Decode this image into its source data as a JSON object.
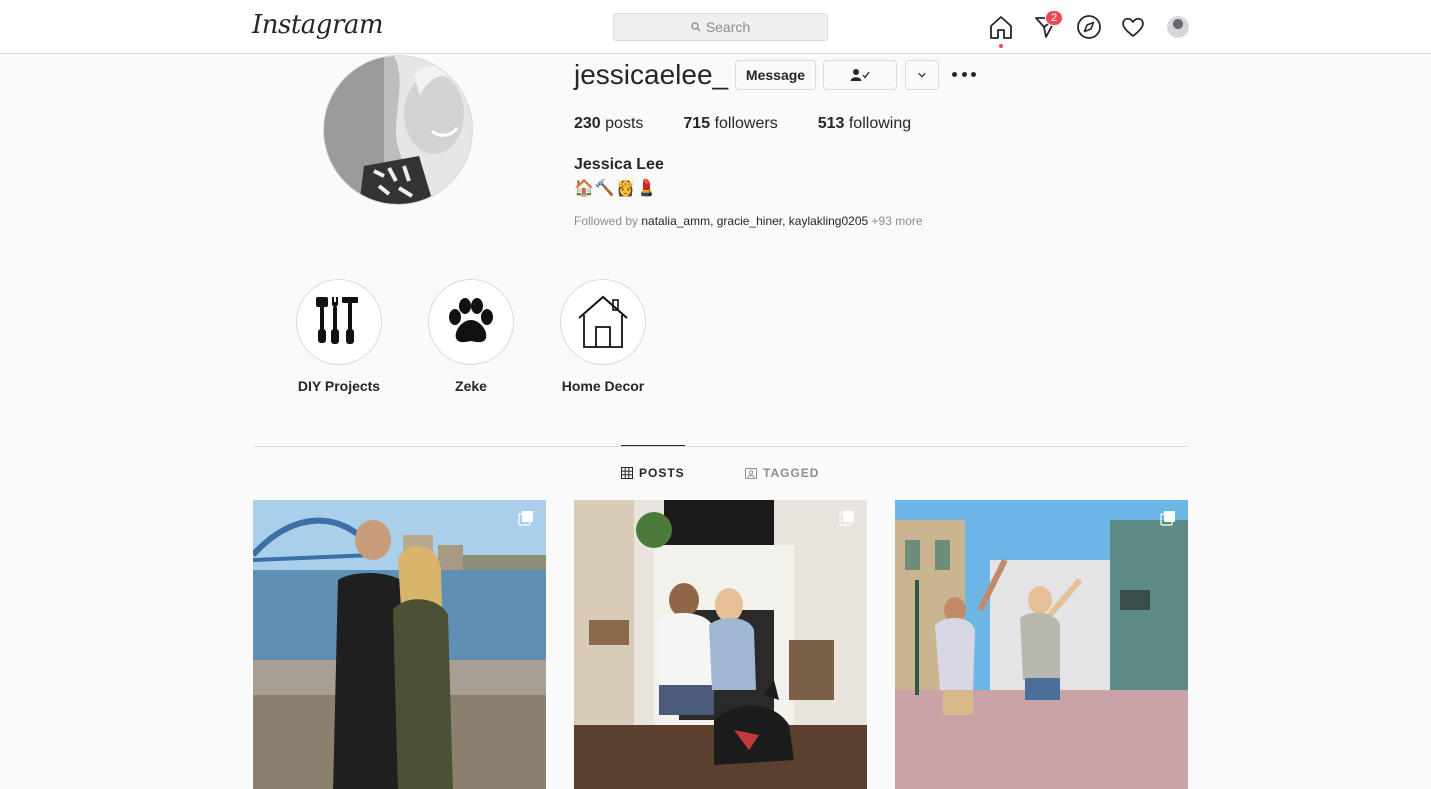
{
  "nav": {
    "logo": "Instagram",
    "search_placeholder": "Search",
    "messages_badge": "2",
    "icons": [
      "home-icon",
      "direct-icon",
      "explore-icon",
      "heart-icon",
      "avatar"
    ]
  },
  "profile": {
    "username": "jessicaelee_",
    "message_label": "Message",
    "stats": [
      {
        "count": "230",
        "label": "posts"
      },
      {
        "count": "715",
        "label": "followers"
      },
      {
        "count": "513",
        "label": "following"
      }
    ],
    "full_name": "Jessica Lee",
    "bio": "🏠🔨👸💄",
    "followed_by_prefix": "Followed by",
    "followed_by_names": "natalia_amm, gracie_hiner, kaylakling0205",
    "followed_by_more": "+93 more"
  },
  "highlights": [
    {
      "label": "DIY Projects",
      "icon": "tools-icon"
    },
    {
      "label": "Zeke",
      "icon": "paw-icon"
    },
    {
      "label": "Home Decor",
      "icon": "house-icon"
    }
  ],
  "tabs": [
    {
      "label": "POSTS",
      "icon": "grid-icon",
      "active": true
    },
    {
      "label": "TAGGED",
      "icon": "tagged-icon",
      "active": false
    }
  ],
  "colors": {
    "accent_red": "#ed4956",
    "border": "#dbdbdb",
    "text": "#262626",
    "muted": "#8e8e8e"
  }
}
